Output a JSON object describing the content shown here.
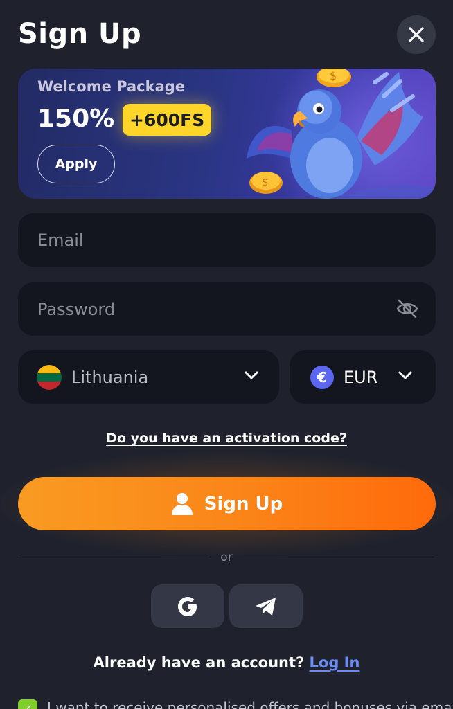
{
  "header": {
    "title": "Sign Up"
  },
  "banner": {
    "subtitle": "Welcome Package",
    "percent": "150%",
    "free_spins": "+600FS",
    "apply_label": "Apply"
  },
  "form": {
    "email_placeholder": "Email",
    "password_placeholder": "Password",
    "country": {
      "label": "Lithuania",
      "flag_colors": [
        "#fdb913",
        "#006a44",
        "#c1272d"
      ]
    },
    "currency": {
      "label": "EUR",
      "symbol": "€"
    },
    "activation_link": "Do you have an activation code?",
    "submit_label": "Sign Up"
  },
  "social": {
    "divider_text": "or",
    "providers": [
      "google-icon",
      "telegram-icon"
    ]
  },
  "footer": {
    "login_prompt": "Already have an account?",
    "login_link": "Log In",
    "consent_text": "I want to receive personalised offers and bonuses via email"
  },
  "colors": {
    "background": "#1f222d",
    "field": "#14161f",
    "accent_orange": "#fb8418",
    "highlight_yellow": "#ffd52a",
    "link_blue": "#6c8cf5",
    "checkbox_green": "#7fcf2c"
  }
}
